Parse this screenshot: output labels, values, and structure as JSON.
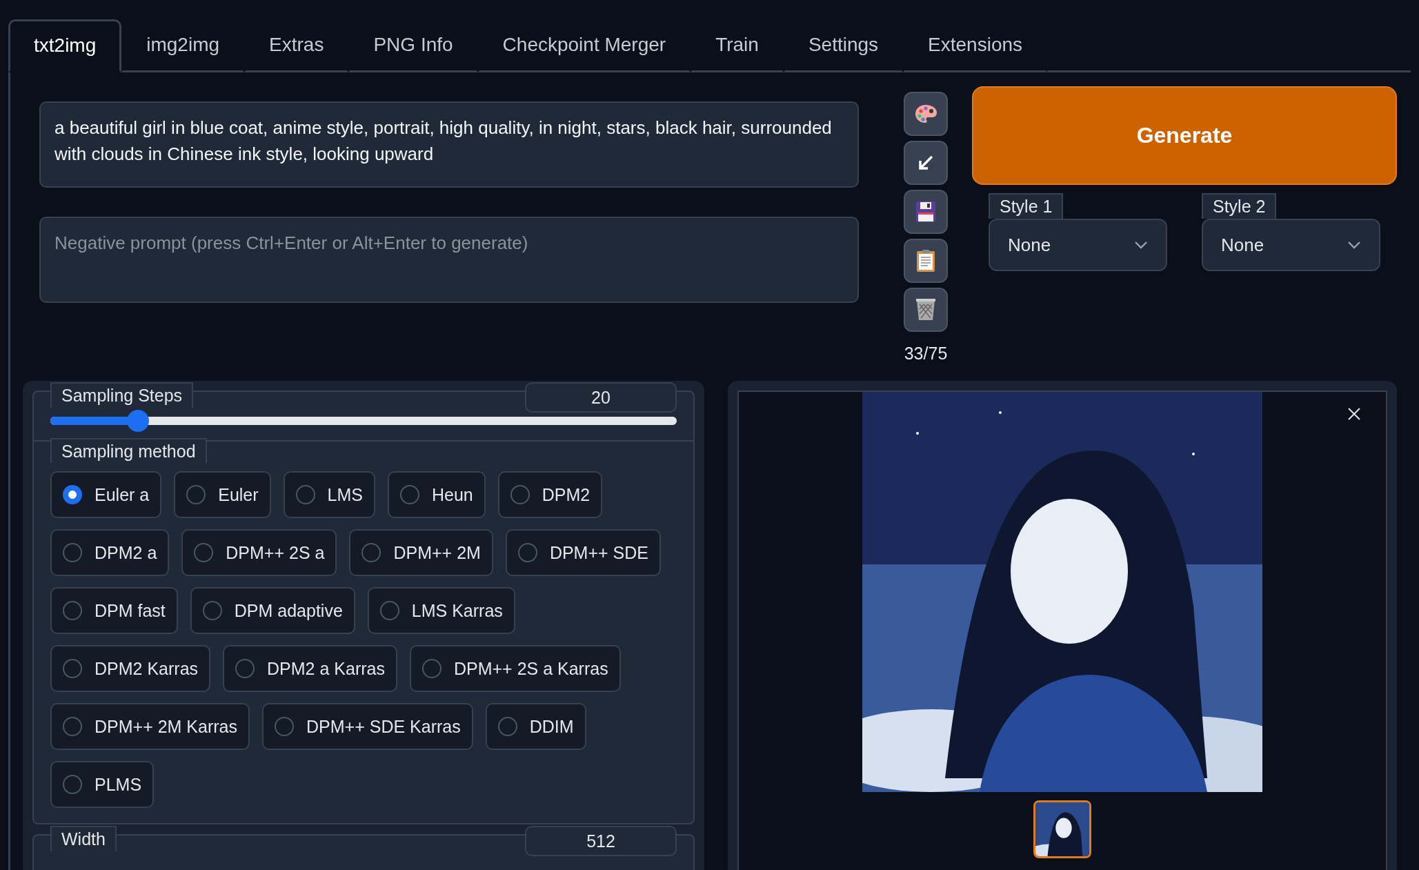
{
  "tabs": [
    {
      "label": "txt2img",
      "selected": true
    },
    {
      "label": "img2img",
      "selected": false
    },
    {
      "label": "Extras",
      "selected": false
    },
    {
      "label": "PNG Info",
      "selected": false
    },
    {
      "label": "Checkpoint Merger",
      "selected": false
    },
    {
      "label": "Train",
      "selected": false
    },
    {
      "label": "Settings",
      "selected": false
    },
    {
      "label": "Extensions",
      "selected": false
    }
  ],
  "prompt": {
    "value": "a beautiful girl in blue coat, anime style, portrait, high quality, in night, stars, black hair, surrounded with clouds in Chinese ink style, looking upward"
  },
  "negative_prompt": {
    "placeholder": "Negative prompt (press Ctrl+Enter or Alt+Enter to generate)"
  },
  "token_count": "33/75",
  "generate_button": "Generate",
  "styles": [
    {
      "label": "Style 1",
      "value": "None"
    },
    {
      "label": "Style 2",
      "value": "None"
    }
  ],
  "sampling_steps": {
    "label": "Sampling Steps",
    "value": "20",
    "level": 0.14
  },
  "sampling_method": {
    "label": "Sampling method",
    "options": [
      {
        "label": "Euler a",
        "selected": true
      },
      {
        "label": "Euler",
        "selected": false
      },
      {
        "label": "LMS",
        "selected": false
      },
      {
        "label": "Heun",
        "selected": false
      },
      {
        "label": "DPM2",
        "selected": false
      },
      {
        "label": "DPM2 a",
        "selected": false
      },
      {
        "label": "DPM++ 2S a",
        "selected": false
      },
      {
        "label": "DPM++ 2M",
        "selected": false
      },
      {
        "label": "DPM++ SDE",
        "selected": false
      },
      {
        "label": "DPM fast",
        "selected": false
      },
      {
        "label": "DPM adaptive",
        "selected": false
      },
      {
        "label": "LMS Karras",
        "selected": false
      },
      {
        "label": "DPM2 Karras",
        "selected": false
      },
      {
        "label": "DPM2 a Karras",
        "selected": false
      },
      {
        "label": "DPM++ 2S a Karras",
        "selected": false
      },
      {
        "label": "DPM++ 2M Karras",
        "selected": false
      },
      {
        "label": "DPM++ SDE Karras",
        "selected": false
      },
      {
        "label": "DDIM",
        "selected": false
      },
      {
        "label": "PLMS",
        "selected": false
      }
    ]
  },
  "width": {
    "label": "Width",
    "value": "512"
  },
  "gallery": {
    "image": {
      "kind": "picture"
    },
    "thumbnails": [
      {
        "kind": "picture",
        "selected": true
      }
    ]
  }
}
